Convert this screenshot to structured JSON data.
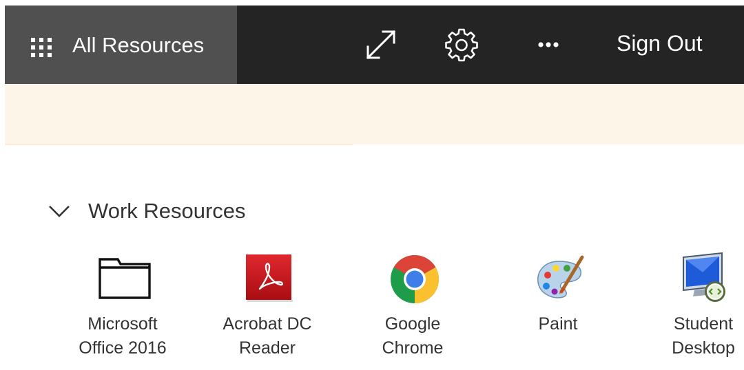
{
  "header": {
    "all_resources_label": "All Resources",
    "icons": {
      "grid": "app-grid-icon",
      "expand": "expand-icon",
      "settings": "gear-icon",
      "more": "more-options-icon"
    },
    "sign_out_label": "Sign Out"
  },
  "section": {
    "title": "Work Resources",
    "toggle_icon": "chevron-down-icon"
  },
  "resources": [
    {
      "line1": "Microsoft",
      "line2": "Office 2016",
      "icon": "folder-icon"
    },
    {
      "line1": "Acrobat DC",
      "line2": "Reader",
      "icon": "acrobat-reader-icon"
    },
    {
      "line1": "Google",
      "line2": "Chrome",
      "icon": "chrome-icon"
    },
    {
      "line1": "Paint",
      "line2": "",
      "icon": "paint-palette-icon"
    },
    {
      "line1": "Student",
      "line2": "Desktop",
      "icon": "remote-desktop-icon"
    }
  ],
  "colors": {
    "topbar": "#242424",
    "active_tab": "#505050",
    "banner": "#fdf6e8",
    "acrobat_red": "#c8161d",
    "chrome_green": "#1e9c4a",
    "chrome_yellow": "#fbc02d",
    "chrome_red": "#db4437",
    "chrome_blue": "#3f7ee8"
  }
}
